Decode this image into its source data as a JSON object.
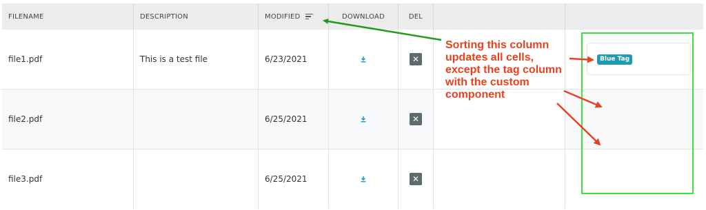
{
  "table": {
    "headers": {
      "filename": "FILENAME",
      "description": "DESCRIPTION",
      "modified": "MODIFIED",
      "download": "DOWNLOAD",
      "del": "DEL"
    },
    "rows": [
      {
        "filename": "file1.pdf",
        "description": "This is a test file",
        "modified": "6/23/2021",
        "delete_glyph": "✕"
      },
      {
        "filename": "file2.pdf",
        "description": "",
        "modified": "6/25/2021",
        "delete_glyph": "✕"
      },
      {
        "filename": "file3.pdf",
        "description": "",
        "modified": "6/25/2021",
        "delete_glyph": "✕"
      }
    ],
    "tag_label": "Blue Tag"
  },
  "annotation": {
    "lines": [
      "Sorting this column",
      "updates all cells,",
      "except the tag column",
      "with the custom",
      "component"
    ]
  },
  "colors": {
    "tag": "#1f9bb0",
    "annotation_text": "#e8411e",
    "green_arrow": "#1e9a1e",
    "highlight_box": "#3de23d",
    "delete_button": "#5b6b6e",
    "download_icon": "#2a9ec0"
  },
  "icons": {
    "sort": "sort-lines-icon",
    "download": "download-icon",
    "delete": "close-icon"
  }
}
